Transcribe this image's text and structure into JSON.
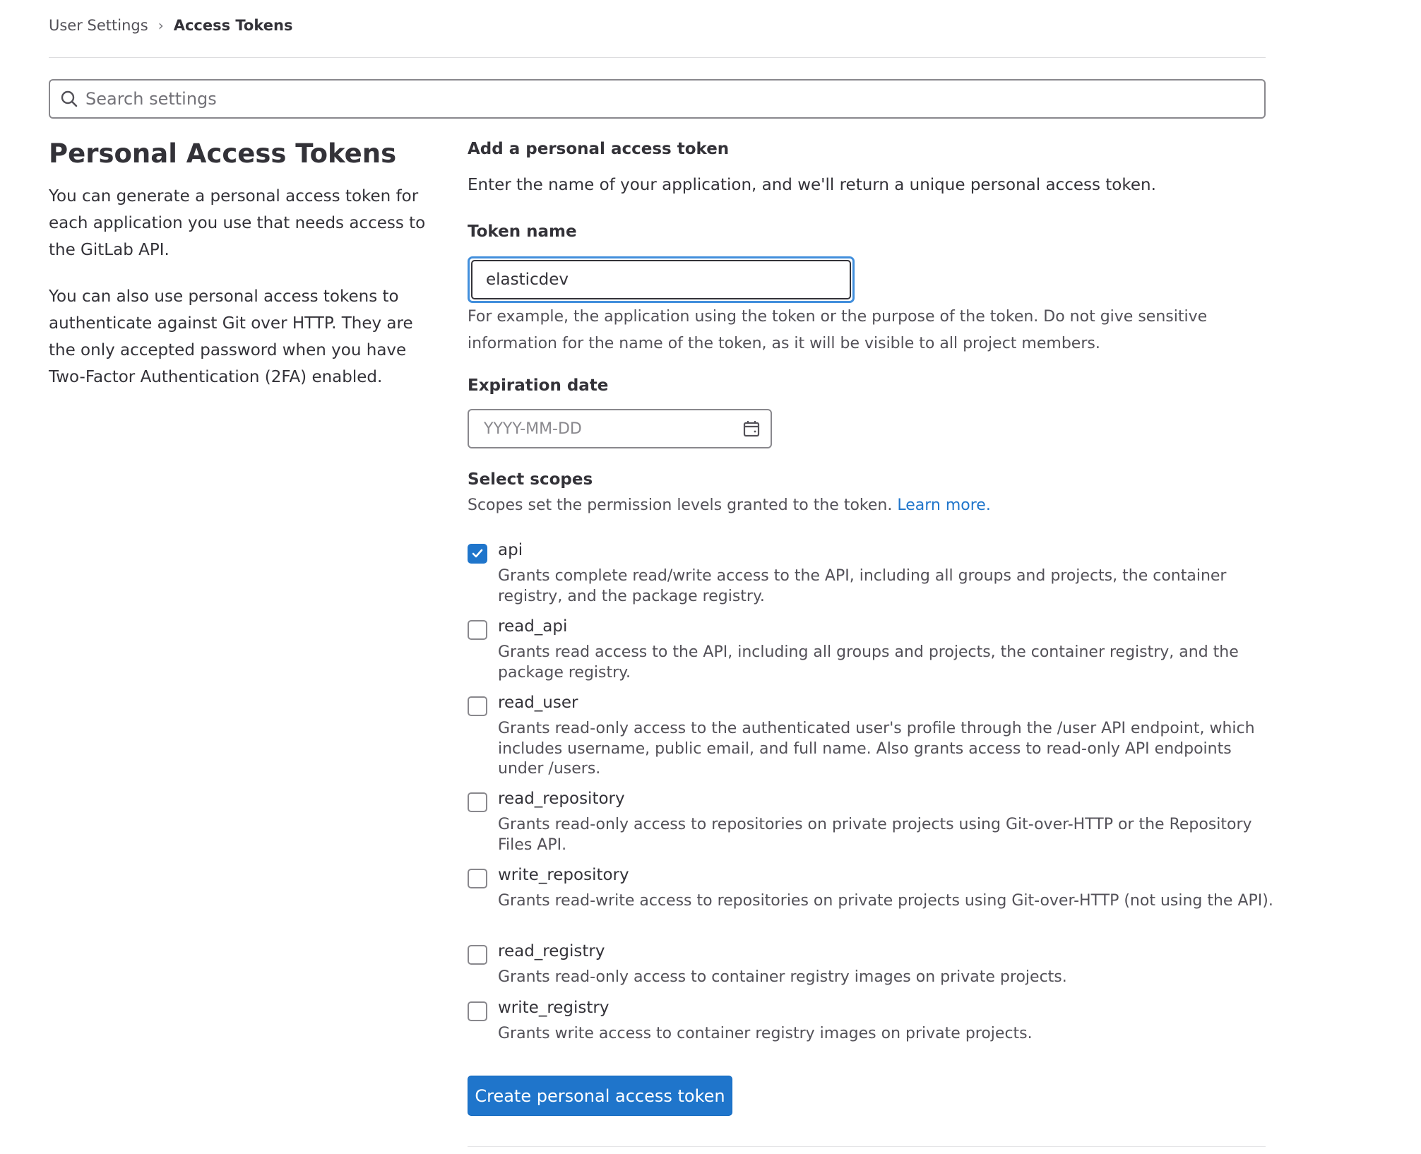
{
  "breadcrumb": {
    "items": [
      {
        "label": "User Settings"
      },
      {
        "label": "Access Tokens"
      }
    ],
    "separator": "›"
  },
  "search": {
    "placeholder": "Search settings",
    "value": ""
  },
  "left": {
    "title": "Personal Access Tokens",
    "paragraph1": "You can generate a personal access token for each application you use that needs access to the GitLab API.",
    "paragraph2": "You can also use personal access tokens to authenticate against Git over HTTP. They are the only accepted password when you have Two-Factor Authentication (2FA) enabled."
  },
  "form": {
    "heading": "Add a personal access token",
    "subtitle": "Enter the name of your application, and we'll return a unique personal access token.",
    "token_name": {
      "label": "Token name",
      "value": "elasticdev",
      "help": "For example, the application using the token or the purpose of the token. Do not give sensitive information for the name of the token, as it will be visible to all project members."
    },
    "expiration": {
      "label": "Expiration date",
      "placeholder": "YYYY-MM-DD",
      "icon": "calendar-icon"
    },
    "scopes": {
      "label": "Select scopes",
      "description": "Scopes set the permission levels granted to the token.",
      "learn_more": "Learn more.",
      "items": [
        {
          "name": "api",
          "checked": true,
          "description": "Grants complete read/write access to the API, including all groups and projects, the container registry, and the package registry."
        },
        {
          "name": "read_api",
          "checked": false,
          "description": "Grants read access to the API, including all groups and projects, the container registry, and the package registry."
        },
        {
          "name": "read_user",
          "checked": false,
          "description": "Grants read-only access to the authenticated user's profile through the /user API endpoint, which includes username, public email, and full name. Also grants access to read-only API endpoints under /users."
        },
        {
          "name": "read_repository",
          "checked": false,
          "description": "Grants read-only access to repositories on private projects using Git-over-HTTP or the Repository Files API."
        },
        {
          "name": "write_repository",
          "checked": false,
          "description": "Grants read-write access to repositories on private projects using Git-over-HTTP (not using the API)."
        },
        {
          "name": "read_registry",
          "checked": false,
          "description": "Grants read-only access to container registry images on private projects."
        },
        {
          "name": "write_registry",
          "checked": false,
          "description": "Grants write access to container registry images on private projects."
        }
      ]
    },
    "submit_label": "Create personal access token"
  },
  "colors": {
    "primary": "#1f75cb",
    "focus_ring": "#428fdc",
    "text": "#333238",
    "muted": "#535158"
  }
}
